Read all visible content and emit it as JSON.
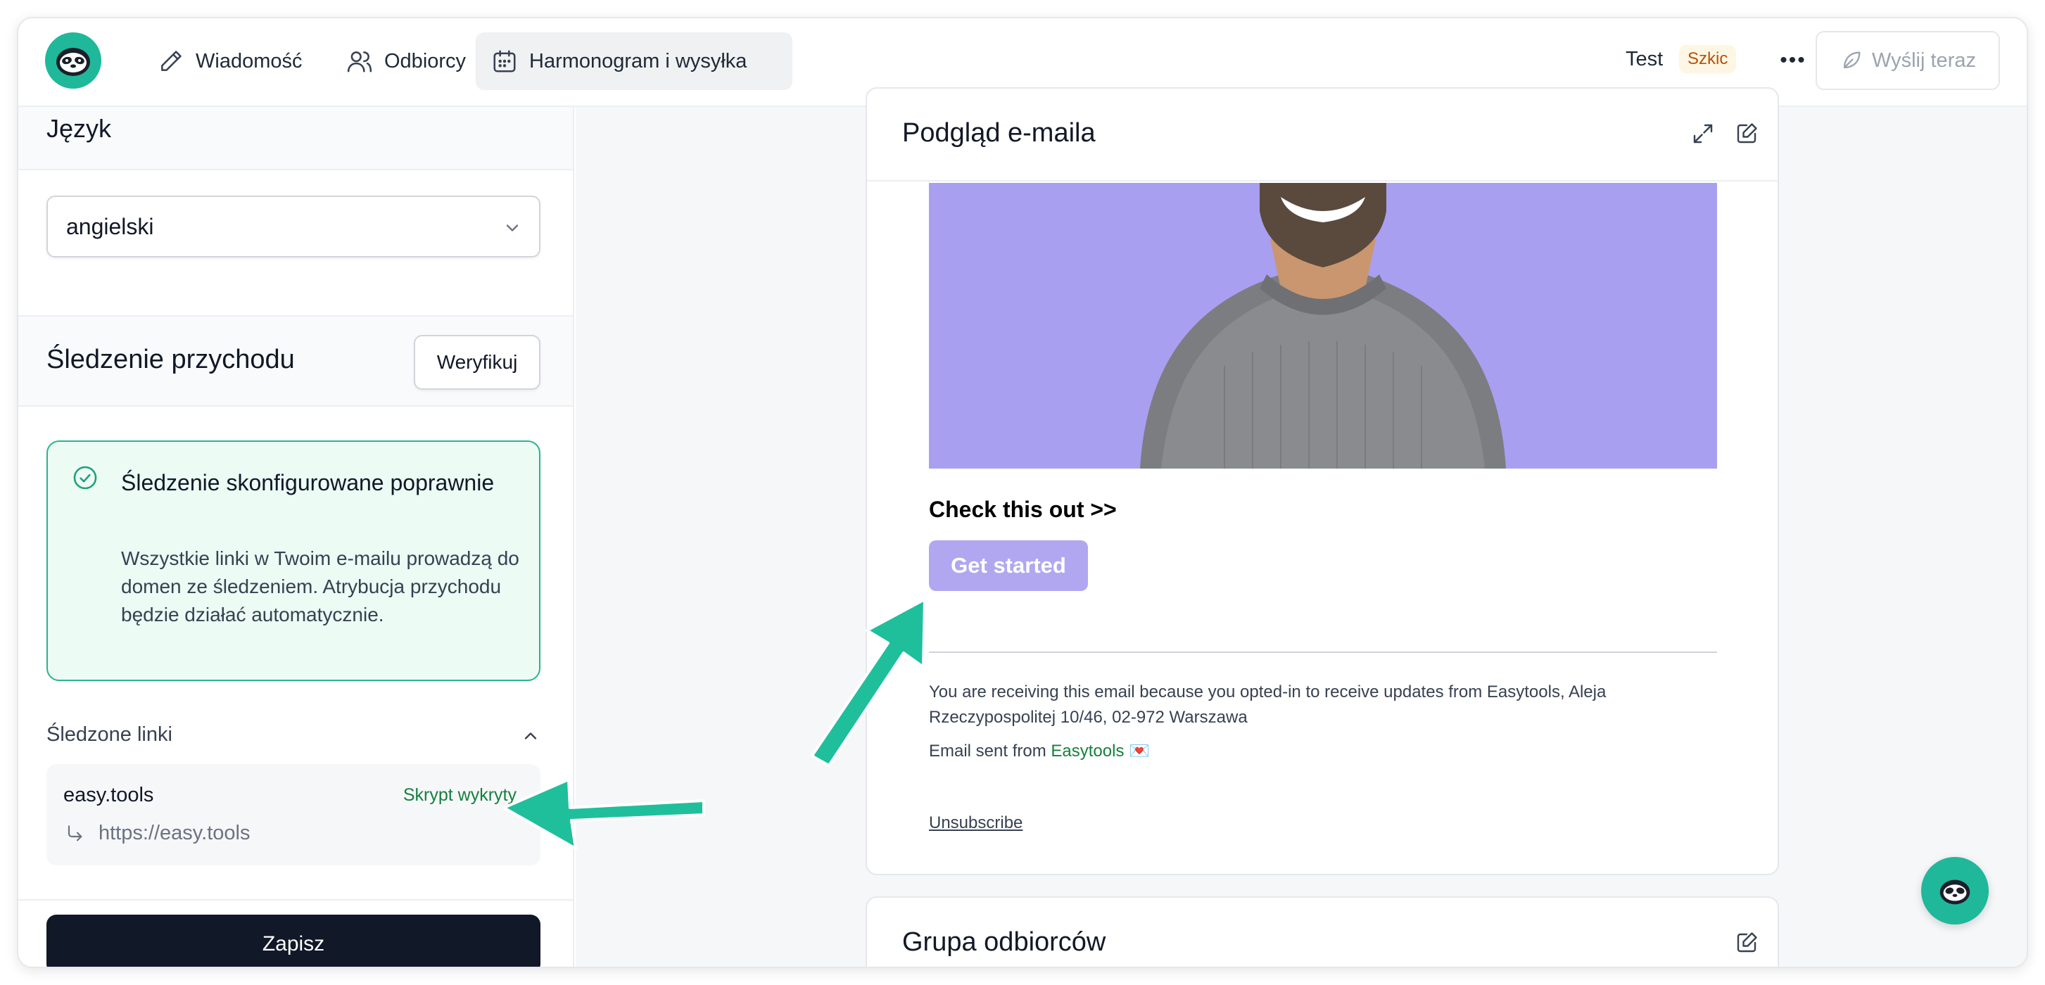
{
  "topbar": {
    "tabs": [
      {
        "label": "Wiadomość",
        "icon": "pencil-icon"
      },
      {
        "label": "Odbiorcy",
        "icon": "users-icon"
      },
      {
        "label": "Harmonogram i wysyłka",
        "icon": "calendar-icon",
        "active": true
      }
    ],
    "campaign_name": "Test",
    "status_badge": "Szkic",
    "more_label": "•••",
    "send_label": "Wyślij teraz"
  },
  "sidebar": {
    "language_heading": "Język",
    "language_value": "angielski",
    "tracking_heading": "Śledzenie przychodu",
    "verify_label": "Weryfikuj",
    "success_title": "Śledzenie skonfigurowane poprawnie",
    "success_body": "Wszystkie linki w Twoim e-mailu prowadzą do domen ze śledzeniem. Atrybucja przychodu będzie działać automatycznie.",
    "tracked_links_heading": "Śledzone linki",
    "tracked_links": [
      {
        "domain": "easy.tools",
        "status": "Skrypt wykryty",
        "url": "https://easy.tools"
      }
    ],
    "save_label": "Zapisz"
  },
  "preview": {
    "title": "Podgląd e-maila",
    "email_heading": "Check this out >>",
    "email_button": "Get started",
    "footer_line1": "You are receiving this email because you opted-in to receive updates from Easytools, Aleja Rzeczypospolitej 10/46, 02-972 Warszawa",
    "footer_sent_prefix": "Email sent from ",
    "footer_sent_link": "Easytools",
    "footer_sent_emoji": "💌",
    "unsubscribe": "Unsubscribe"
  },
  "group": {
    "title": "Grupa odbiorców"
  },
  "colors": {
    "brand": "#1fb89a",
    "accent_arrow": "#1fbf9c",
    "email_image_bg": "#a79cf0",
    "email_button_bg": "#b1a7f0"
  }
}
